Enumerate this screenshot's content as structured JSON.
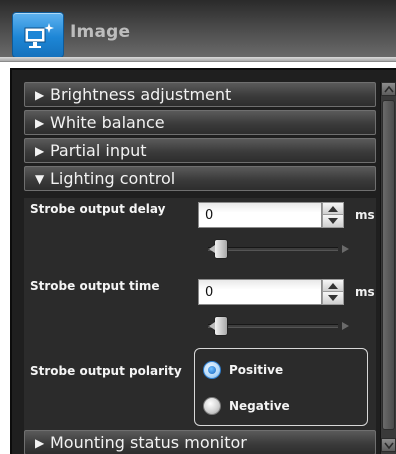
{
  "header": {
    "title": "Image",
    "icon": "monitor-sparkle-icon"
  },
  "sections": [
    {
      "label": "Brightness adjustment",
      "expanded": false
    },
    {
      "label": "White balance",
      "expanded": false
    },
    {
      "label": "Partial input",
      "expanded": false
    },
    {
      "label": "Lighting control",
      "expanded": true
    },
    {
      "label": "Mounting status monitor",
      "expanded": false
    }
  ],
  "arrows": {
    "collapsed": "▶",
    "expanded": "▼"
  },
  "lighting": {
    "strobe_delay": {
      "label": "Strobe output delay",
      "value": "0",
      "unit": "ms",
      "slider_level": 0
    },
    "strobe_time": {
      "label": "Strobe output time",
      "value": "0",
      "unit": "ms",
      "slider_level": 0
    },
    "polarity": {
      "label": "Strobe output polarity",
      "options": [
        {
          "label": "Positive",
          "selected": true
        },
        {
          "label": "Negative",
          "selected": false
        }
      ]
    }
  },
  "colors": {
    "accent": "#1d86d6",
    "panel_bg": "#1f1f1f",
    "section_header": "#3b3b3b"
  }
}
